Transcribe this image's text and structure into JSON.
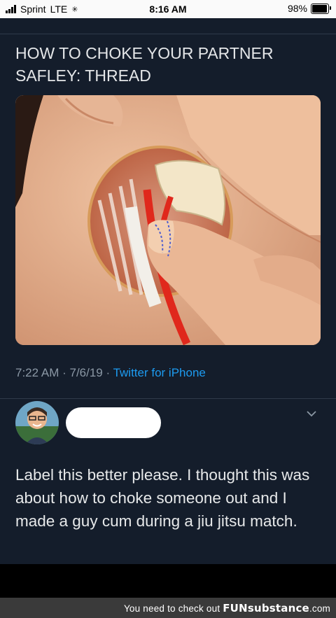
{
  "status_bar": {
    "carrier": "Sprint",
    "network": "LTE",
    "time": "8:16 AM",
    "battery": "98%",
    "battery_level": 0.98
  },
  "tweet": {
    "text": "HOW TO CHOKE YOUR PARTNER\nSAFLEY: THREAD",
    "time": "7:22 AM",
    "date": "7/6/19",
    "source": "Twitter for iPhone"
  },
  "reply": {
    "text": "Label this better please. I thought this was about how to choke someone out and I made a guy cum during a jiu jitsu match."
  },
  "watermark": {
    "prefix": "You need to check out",
    "brand": "FUNsubstance",
    "suffix": ".com"
  },
  "colors": {
    "background": "#141d2b",
    "link": "#1d9bf0",
    "muted": "#8b98a5",
    "artery": "#e0281c"
  }
}
